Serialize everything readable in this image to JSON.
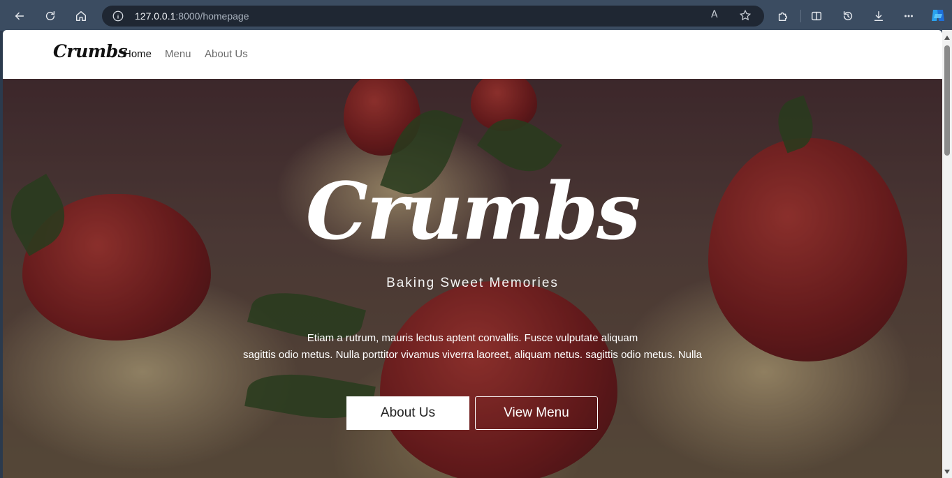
{
  "browser": {
    "url_host": "127.0.0.1",
    "url_rest": ":8000/homepage",
    "read_aloud_icon": "A",
    "icons": [
      "back-icon",
      "refresh-icon",
      "home-icon",
      "info-icon",
      "read-aloud-icon",
      "favorite-star-icon",
      "extensions-icon",
      "split-screen-icon",
      "history-icon",
      "download-icon",
      "more-icon",
      "copilot-icon"
    ]
  },
  "nav": {
    "brand": "Crumbs",
    "links": [
      "Home",
      "Menu",
      "About Us"
    ]
  },
  "hero": {
    "title": "Crumbs",
    "subtitle": "Baking Sweet Memories",
    "line1": "Etiam a rutrum, mauris lectus aptent convallis. Fusce vulputate aliquam",
    "line2": "sagittis odio metus. Nulla porttitor vivamus viverra laoreet, aliquam netus. sagittis odio metus. Nulla",
    "button_about": "About Us",
    "button_menu": "View Menu"
  }
}
